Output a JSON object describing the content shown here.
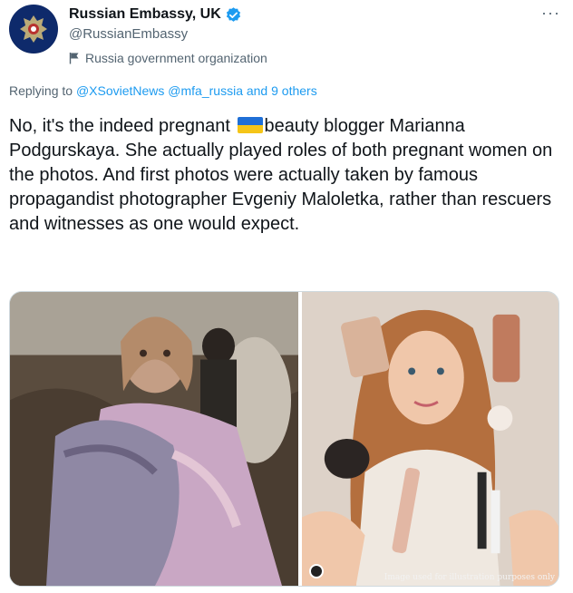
{
  "account": {
    "display_name": "Russian Embassy, UK",
    "handle": "@RussianEmbassy",
    "label": "Russia government organization"
  },
  "icons": {
    "avatar": "embassy-crest",
    "verified": "verified-badge",
    "label": "flag-icon",
    "more": "more-icon"
  },
  "more_glyph": "···",
  "reply": {
    "prefix": "Replying to",
    "mentions": "@XSovietNews @mfa_russia and 9 others"
  },
  "tweet": {
    "part1": "No, it's the indeed pregnant",
    "part2": "beauty blogger Marianna Podgurskaya. She actually played roles of both pregnant women on the photos. And first photos were actually taken by famous propagandist photographer Evgeniy Maloletka, rather than rescuers and witnesses as one would expect.",
    "emoji": "ukraine-flag"
  },
  "media": {
    "caption": "Image used for illustration purposes only"
  },
  "colors": {
    "link": "#1d9bf0",
    "secondary_text": "#536471",
    "verified": "#1d9bf0"
  }
}
